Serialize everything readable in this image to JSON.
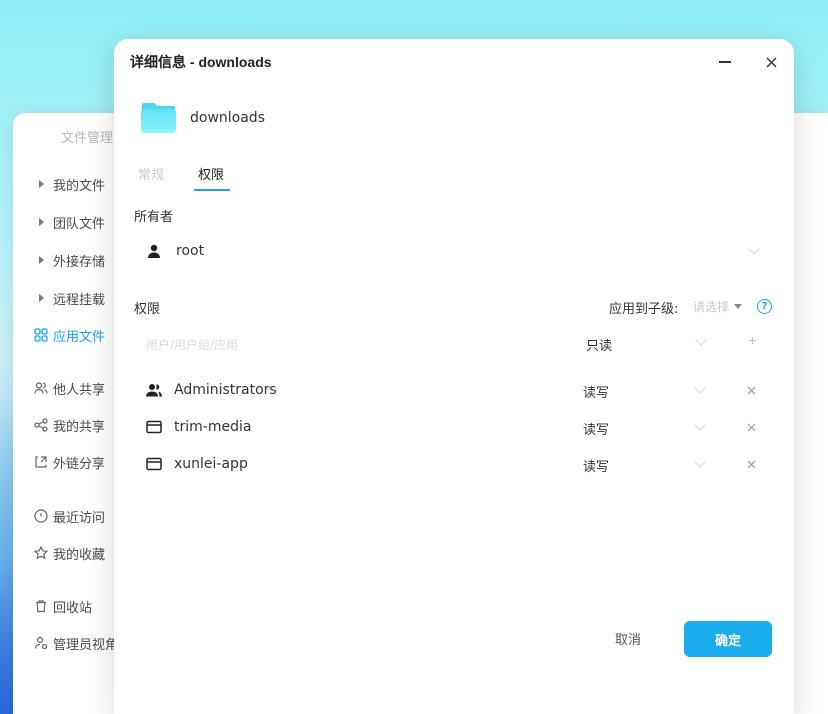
{
  "file_manager": {
    "title": "文件管理",
    "nav": [
      {
        "label": "我的文件",
        "icon": "caret-right-icon"
      },
      {
        "label": "团队文件",
        "icon": "caret-right-icon"
      },
      {
        "label": "外接存储",
        "icon": "caret-right-icon"
      },
      {
        "label": "远程挂载",
        "icon": "caret-right-icon"
      },
      {
        "label": "应用文件",
        "icon": "grid-icon",
        "active": true
      },
      {
        "label": "他人共享",
        "icon": "users-icon"
      },
      {
        "label": "我的共享",
        "icon": "share-icon"
      },
      {
        "label": "外链分享",
        "icon": "link-share-icon"
      },
      {
        "label": "最近访问",
        "icon": "clock-icon"
      },
      {
        "label": "我的收藏",
        "icon": "star-icon"
      },
      {
        "label": "回收站",
        "icon": "trash-icon"
      },
      {
        "label": "管理员视角",
        "icon": "admin-view-icon"
      }
    ]
  },
  "dialog": {
    "title": "详细信息 - downloads",
    "folder_name": "downloads",
    "tabs": [
      {
        "label": "常规",
        "active": false
      },
      {
        "label": "权限",
        "active": true
      }
    ],
    "owner_label": "所有者",
    "owner_value": "root",
    "permission_label": "权限",
    "apply_to_children_label": "应用到子级:",
    "apply_to_children_value": "请选择",
    "header_placeholder": "用户/用户组/应用",
    "header_value": "只读",
    "entries": [
      {
        "name": "Administrators",
        "type": "group",
        "permission": "读写"
      },
      {
        "name": "trim-media",
        "type": "app",
        "permission": "读写"
      },
      {
        "name": "xunlei-app",
        "type": "app",
        "permission": "读写"
      }
    ],
    "cancel_label": "取消",
    "ok_label": "确定"
  },
  "colors": {
    "accent": "#17a7e8",
    "primary_button": "#1aadee"
  }
}
